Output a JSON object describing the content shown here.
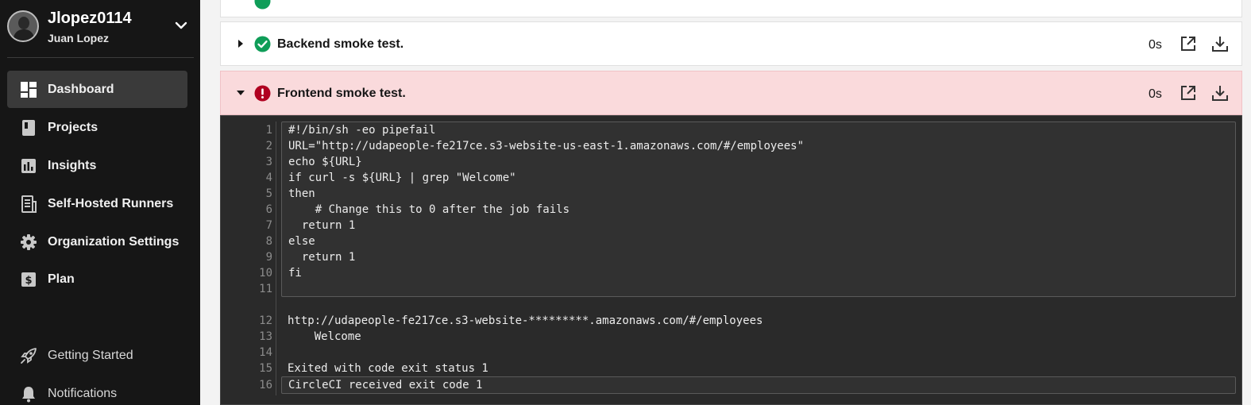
{
  "user": {
    "username": "Jlopez0114",
    "full_name": "Juan Lopez"
  },
  "sidebar": {
    "items": [
      {
        "label": "Dashboard",
        "icon": "dashboard-icon",
        "active": true
      },
      {
        "label": "Projects",
        "icon": "book-icon"
      },
      {
        "label": "Insights",
        "icon": "bar-chart-icon"
      },
      {
        "label": "Self-Hosted Runners",
        "icon": "runner-icon"
      },
      {
        "label": "Organization Settings",
        "icon": "gear-icon"
      },
      {
        "label": "Plan",
        "icon": "dollar-icon"
      }
    ],
    "footer": [
      {
        "label": "Getting Started",
        "icon": "rocket-icon"
      },
      {
        "label": "Notifications",
        "icon": "bell-icon"
      }
    ]
  },
  "steps": [
    {
      "title": "Backend smoke test.",
      "duration": "0s",
      "status": "success"
    },
    {
      "title": "Frontend smoke test.",
      "duration": "0s",
      "status": "failed"
    }
  ],
  "terminal": {
    "lines": [
      {
        "n": "1",
        "text": "#!/bin/sh -eo pipefail"
      },
      {
        "n": "2",
        "text": "URL=\"http://udapeople-fe217ce.s3-website-us-east-1.amazonaws.com/#/employees\""
      },
      {
        "n": "3",
        "text": "echo ${URL}"
      },
      {
        "n": "4",
        "text": "if curl -s ${URL} | grep \"Welcome\""
      },
      {
        "n": "5",
        "text": "then"
      },
      {
        "n": "6",
        "text": "    # Change this to 0 after the job fails"
      },
      {
        "n": "7",
        "text": "  return 1"
      },
      {
        "n": "8",
        "text": "else"
      },
      {
        "n": "9",
        "text": "  return 1"
      },
      {
        "n": "10",
        "text": "fi"
      },
      {
        "n": "11",
        "text": ""
      },
      {
        "n": "12",
        "text": "http://udapeople-fe217ce.s3-website-*********.amazonaws.com/#/employees"
      },
      {
        "n": "13",
        "text": "    Welcome"
      },
      {
        "n": "14",
        "text": ""
      },
      {
        "n": "15",
        "text": "Exited with code exit status 1"
      },
      {
        "n": "16",
        "text": "CircleCI received exit code 1"
      }
    ]
  },
  "colors": {
    "success": "#0f9d58",
    "failed": "#b00020",
    "sidebar_bg": "#161616",
    "failed_row_bg": "#fadadc"
  }
}
